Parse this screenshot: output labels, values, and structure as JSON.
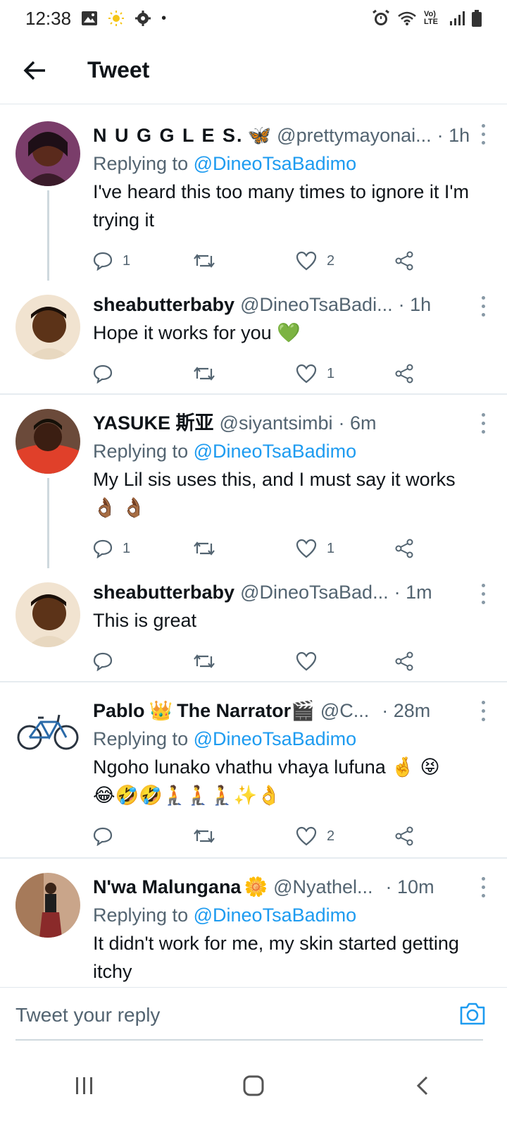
{
  "status_bar": {
    "time": "12:38",
    "dot": "•",
    "network": "Vo) LTE"
  },
  "header": {
    "title": "Tweet"
  },
  "tweets": [
    {
      "name": "N U G G L E S.",
      "name_emoji": "🦋",
      "handle": "@prettymayonai...",
      "time": "· 1h",
      "replying_prefix": "Replying to",
      "replying_to": "@DineoTsaBadimo",
      "text": "I've heard this too many times to ignore it I'm trying it",
      "reply_count": "1",
      "retweet_count": "",
      "like_count": "2",
      "avatar_color": "#5a2a3a"
    },
    {
      "name": "sheabutterbaby",
      "name_emoji": "",
      "handle": "@DineoTsaBadi...",
      "time": "· 1h",
      "text": "Hope it works for you",
      "text_emoji": "💚",
      "reply_count": "",
      "retweet_count": "",
      "like_count": "1",
      "avatar_color": "#f2d7b8"
    },
    {
      "name": "YASUKE 斯亚",
      "name_emoji": "",
      "handle": "@siyantsimbi",
      "time": "· 6m",
      "replying_prefix": "Replying to",
      "replying_to": "@DineoTsaBadimo",
      "text": "My Lil sis uses this, and I must say it works",
      "text_emoji": "👌🏾 👌🏾",
      "reply_count": "1",
      "retweet_count": "",
      "like_count": "1",
      "avatar_color": "#7a3b2a"
    },
    {
      "name": "sheabutterbaby",
      "name_emoji": "",
      "handle": "@DineoTsaBad...",
      "time": "· 1m",
      "text": "This is great",
      "reply_count": "",
      "retweet_count": "",
      "like_count": "",
      "avatar_color": "#f2d7b8"
    },
    {
      "name": "Pablo",
      "name_emoji": "👑",
      "name_suffix": "The Narrator",
      "name_suffix_emoji": "🎬",
      "handle": "@C...",
      "time": "· 28m",
      "replying_prefix": "Replying to",
      "replying_to": "@DineoTsaBadimo",
      "text": "Ngoho lunako vhathu vhaya lufuna",
      "text_emoji": "🤞 😝",
      "text_line2": "😂🤣🤣🧎🧎🧎✨👌",
      "reply_count": "",
      "retweet_count": "",
      "like_count": "2",
      "avatar_color": "#ffffff"
    },
    {
      "name": "N'wa Malungana",
      "name_emoji": "🌼",
      "handle": "@Nyathel...",
      "time": "· 10m",
      "replying_prefix": "Replying to",
      "replying_to": "@DineoTsaBadimo",
      "text": "It didn't work for me, my skin started getting itchy",
      "avatar_color": "#b06a4a"
    }
  ],
  "composer": {
    "placeholder": "Tweet your reply"
  },
  "colors": {
    "accent": "#1d9bf0",
    "secondary_text": "#536471",
    "divider": "#e6ecf0"
  }
}
